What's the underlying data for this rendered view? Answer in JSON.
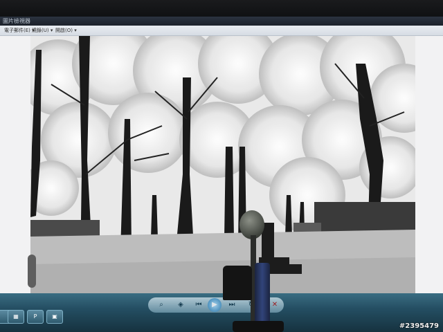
{
  "window": {
    "title": "圖片檢視器"
  },
  "menu": {
    "items": [
      "電子郵件(E)",
      "燒錄(U)",
      "開啟(O)"
    ]
  },
  "photo": {
    "subject": "black-and-white park trees"
  },
  "player": {
    "controls": [
      {
        "icon": "zoom-icon",
        "glyph": "⌕"
      },
      {
        "icon": "fit-icon",
        "glyph": "◈"
      },
      {
        "icon": "previous-icon",
        "glyph": "⏮"
      },
      {
        "icon": "play-slideshow-icon",
        "glyph": "▶"
      },
      {
        "icon": "next-icon",
        "glyph": "⏭"
      },
      {
        "icon": "rotate-icon",
        "glyph": "↻"
      },
      {
        "icon": "delete-icon",
        "glyph": "✕"
      }
    ]
  },
  "taskbar": {
    "apps": [
      {
        "name": "explorer",
        "glyph": "▦"
      },
      {
        "name": "powerpoint",
        "glyph": "P"
      },
      {
        "name": "photo-viewer",
        "glyph": "▣"
      }
    ]
  },
  "watermark": "#2395479"
}
